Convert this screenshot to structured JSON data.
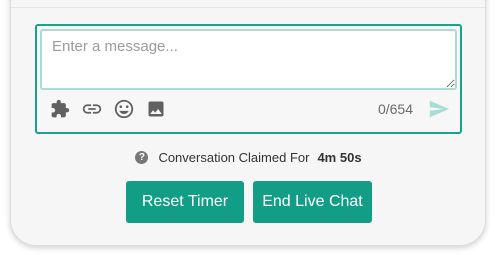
{
  "composer": {
    "placeholder": "Enter a message...",
    "value": "",
    "char_counter": "0/654",
    "toolbar_icons": [
      "puzzle-icon",
      "link-icon",
      "emoji-icon",
      "image-icon"
    ],
    "send_icon": "send-icon"
  },
  "claim": {
    "label": "Conversation Claimed For",
    "duration": "4m 50s",
    "help_icon_glyph": "?"
  },
  "actions": {
    "reset_timer_label": "Reset Timer",
    "end_live_chat_label": "End Live Chat"
  },
  "colors": {
    "accent": "#129e86",
    "composer_border": "#17a38c",
    "input_border": "#a8dcd4",
    "send_icon": "#a8dcd4",
    "icon_gray": "#616161"
  }
}
